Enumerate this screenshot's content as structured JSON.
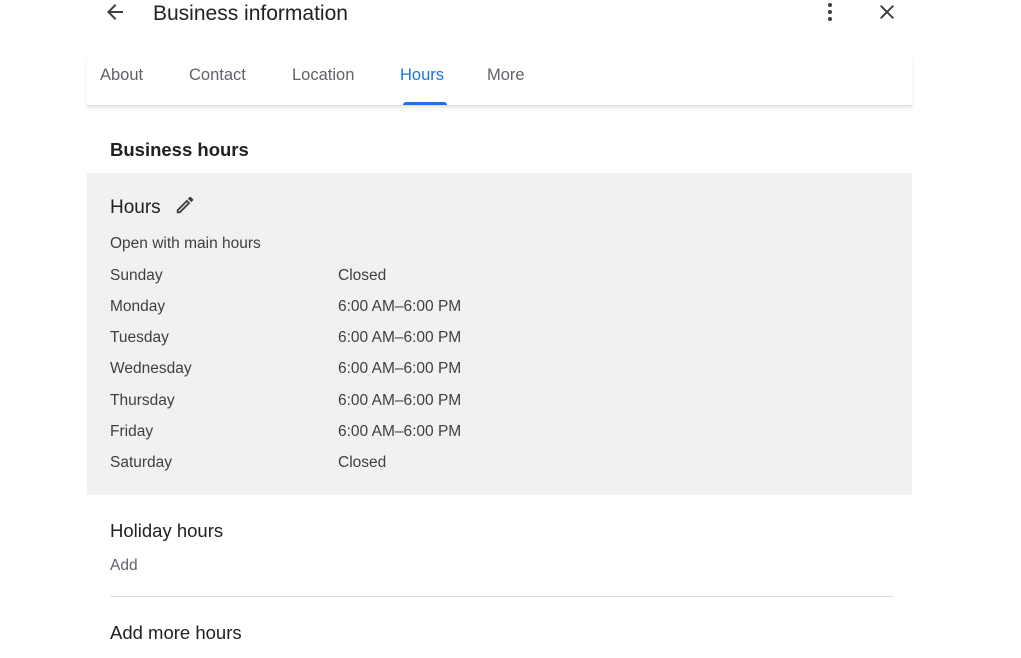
{
  "header": {
    "title": "Business information",
    "back_icon": "arrow-back-icon",
    "more_icon": "more-vert-icon",
    "close_icon": "close-icon"
  },
  "tabs": [
    {
      "label": "About",
      "active": false
    },
    {
      "label": "Contact",
      "active": false
    },
    {
      "label": "Location",
      "active": false
    },
    {
      "label": "Hours",
      "active": true
    },
    {
      "label": "More",
      "active": false
    }
  ],
  "business_hours": {
    "section_title": "Business hours",
    "heading": "Hours",
    "edit_icon": "pencil-icon",
    "status": "Open with main hours",
    "days": [
      {
        "day": "Sunday",
        "hours": "Closed"
      },
      {
        "day": "Monday",
        "hours": "6:00 AM–6:00 PM"
      },
      {
        "day": "Tuesday",
        "hours": "6:00 AM–6:00 PM"
      },
      {
        "day": "Wednesday",
        "hours": "6:00 AM–6:00 PM"
      },
      {
        "day": "Thursday",
        "hours": "6:00 AM–6:00 PM"
      },
      {
        "day": "Friday",
        "hours": "6:00 AM–6:00 PM"
      },
      {
        "day": "Saturday",
        "hours": "Closed"
      }
    ]
  },
  "holiday_hours": {
    "title": "Holiday hours",
    "add_label": "Add"
  },
  "more_hours": {
    "label": "Add more hours"
  },
  "colors": {
    "accent": "#1a73e8",
    "card_background": "#f1f1f1",
    "text_primary": "#202124",
    "text_secondary": "#5f6368"
  }
}
